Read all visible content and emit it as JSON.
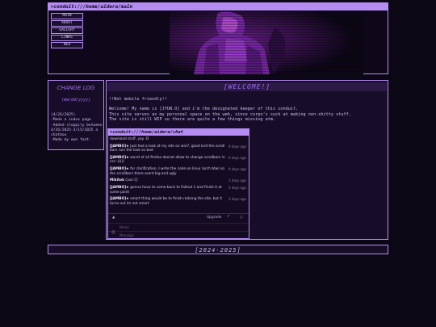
{
  "header": {
    "path": ">conduit:///home/aidera/main",
    "nav": [
      "MAIN",
      "ABOUT",
      "GALLERY",
      "LINKS",
      "NEO"
    ]
  },
  "changelog": {
    "title": "CHANGE LOG",
    "date_format": "(mm/dd/yyyy)",
    "entries": [
      "(4/26/2025)",
      "-Made a index page",
      "-Added sloppily between 4/26/2025-3/15/2025 a chatbox",
      "-Made my own font."
    ]
  },
  "main": {
    "welcome": "[WELCOME!]",
    "notice": "!!Not mobile friendly!!",
    "intro": [
      "Welcome! My name is [JYUN.O] and i'm the designated keeper of this conduit.",
      "This site serves as my personal space on the web, since corpo's suck at making non-shitty stuff.",
      "The site is still WIP so there are quite a few things missing atm."
    ]
  },
  "chat": {
    "path": ">conduit:///home/aidera/chat",
    "messages": [
      {
        "user": "",
        "text": "download stuff, yay :D",
        "time": ""
      },
      {
        "user": "[JAMBO]★",
        "text": "Just had a look at my site on win7, good lord the scroll bars ruin the look so bad",
        "time": "9 days ago"
      },
      {
        "user": "[JAMBO]★",
        "text": "worst of all firefox doesnt allow to change scrollbars in css :(((((",
        "time": "9 days ago"
      },
      {
        "user": "[JAMBO]★",
        "text": "for clarification, I write the code on linux (arch btw) so the scrollbars there arent big and ugly",
        "time": "9 days ago"
      },
      {
        "user": "Mikitok",
        "text": "Cool ☺",
        "time": "3 days ago"
      },
      {
        "user": "[JAMBO]★",
        "text": "gonna have to come back to Fallout 1 and finish it at some point",
        "time": "3 days ago"
      },
      {
        "user": "[JAMBO]★",
        "text": "smart thing would be to finish redoing the site, but it turns out im not smart",
        "time": "3 days ago"
      }
    ],
    "upgrade_label": "Upgrade",
    "name_placeholder": "Name",
    "message_placeholder": "Message"
  },
  "footer": {
    "text": "[2024-2025]"
  }
}
